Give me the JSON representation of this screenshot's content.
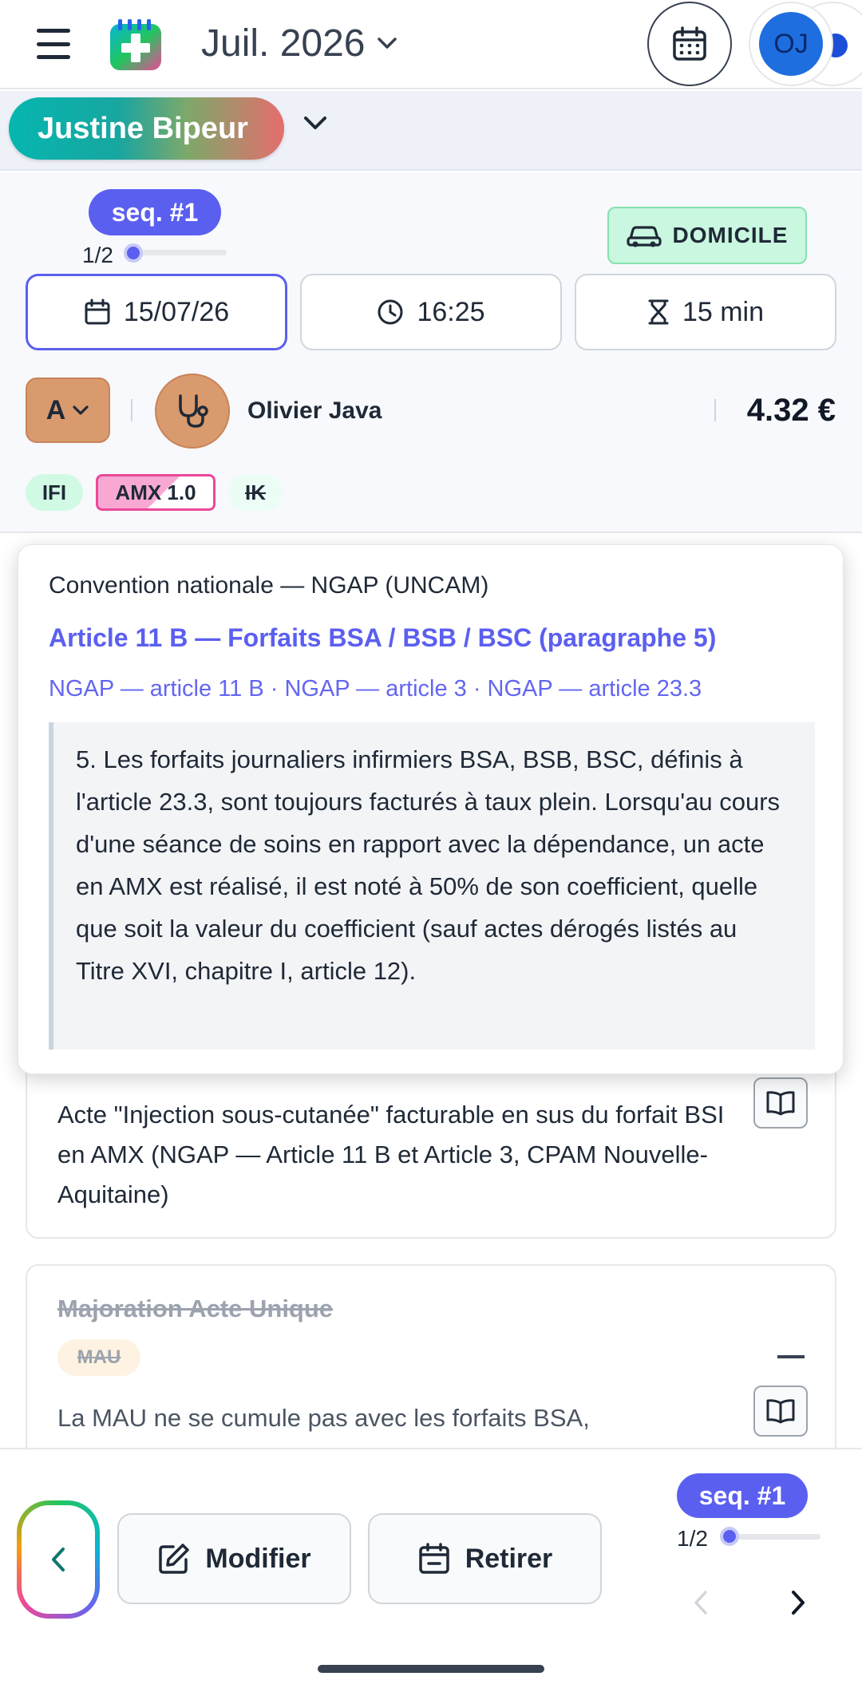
{
  "header": {
    "month_label": "Juil. 2026",
    "avatar_initials": "OJ"
  },
  "patient": {
    "name": "Justine Bipeur"
  },
  "sequence": {
    "badge": "seq. #1",
    "position_label": "1/2",
    "progress": 0.0,
    "location": "DOMICILE",
    "date": "15/07/26",
    "time": "16:25",
    "duration": "15 min",
    "zone": "A",
    "practitioner": "Olivier Java",
    "price": "4.32 €",
    "tags": [
      "IFI",
      "AMX 1.0",
      "IK"
    ]
  },
  "popover": {
    "source": "Convention nationale — NGAP (UNCAM)",
    "title": "Article 11 B — Forfaits BSA / BSB / BSC (paragraphe 5)",
    "refs": "NGAP — article 11 B · NGAP — article 3 · NGAP — article 23.3",
    "quote": "5. Les forfaits journaliers infirmiers BSA, BSB, BSC, définis à l'article 23.3, sont toujours facturés à taux plein. Lorsqu'au cours d'une séance de soins en rapport avec la dépendance, un acte en AMX est réalisé, il est noté à 50% de son coefficient, quelle que soit la valeur du coefficient (sauf actes dérogés listés au Titre XVI, chapitre I, article 12)."
  },
  "cards": {
    "act_text": "Acte \"Injection sous-cutanée\" facturable en sus du forfait BSI en AMX (NGAP — Article 11 B et Article 3, CPAM Nouvelle-Aquitaine)",
    "mau_title": "Majoration Acte Unique",
    "mau_tag": "MAU",
    "mau_text": "La MAU ne se cumule pas avec les forfaits BSA,"
  },
  "footer": {
    "modifier_label": "Modifier",
    "retirer_label": "Retirer",
    "seq_badge": "seq. #1",
    "seq_position": "1/2",
    "progress": 0.0
  },
  "icons": {
    "menu": "hamburger-icon",
    "calendar": "calendar-icon",
    "car": "car-icon",
    "clock": "clock-icon",
    "hourglass": "hourglass-icon",
    "stethoscope": "stethoscope-icon",
    "book": "book-icon",
    "edit": "edit-icon",
    "calendar-remove": "calendar-remove-icon"
  },
  "colors": {
    "accent": "#5b5ff0",
    "domicile_bg": "#c9f7df",
    "zone_bg": "#d99a6e",
    "avatar": "#1e6ee0"
  }
}
